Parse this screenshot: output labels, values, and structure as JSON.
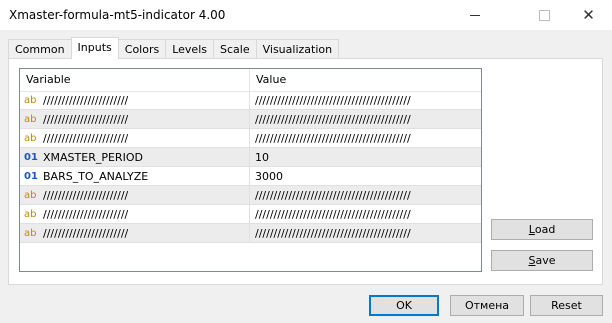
{
  "window": {
    "title": "Xmaster-formula-mt5-indicator 4.00"
  },
  "tabs": [
    {
      "label": "Common"
    },
    {
      "label": "Inputs"
    },
    {
      "label": "Colors"
    },
    {
      "label": "Levels"
    },
    {
      "label": "Scale"
    },
    {
      "label": "Visualization"
    }
  ],
  "active_tab": "Inputs",
  "grid": {
    "headers": {
      "variable": "Variable",
      "value": "Value"
    },
    "rows": [
      {
        "type": "ab",
        "variable": "///////////////////////",
        "value": "//////////////////////////////////////////"
      },
      {
        "type": "ab",
        "variable": "///////////////////////",
        "value": "//////////////////////////////////////////"
      },
      {
        "type": "ab",
        "variable": "///////////////////////",
        "value": "//////////////////////////////////////////"
      },
      {
        "type": "01",
        "variable": "XMASTER_PERIOD",
        "value": "10"
      },
      {
        "type": "01",
        "variable": "BARS_TO_ANALYZE",
        "value": "3000"
      },
      {
        "type": "ab",
        "variable": "///////////////////////",
        "value": "//////////////////////////////////////////"
      },
      {
        "type": "ab",
        "variable": "///////////////////////",
        "value": "//////////////////////////////////////////"
      },
      {
        "type": "ab",
        "variable": "///////////////////////",
        "value": "//////////////////////////////////////////"
      }
    ]
  },
  "side_buttons": {
    "load_accel": "L",
    "load_rest": "oad",
    "save_accel": "S",
    "save_rest": "ave"
  },
  "footer": {
    "ok": "OK",
    "cancel": "Отмена",
    "reset": "Reset"
  }
}
